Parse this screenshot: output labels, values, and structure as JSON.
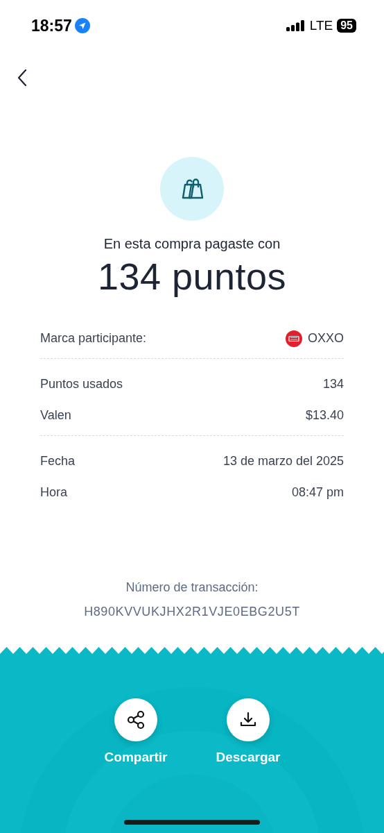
{
  "status_bar": {
    "time": "18:57",
    "network": "LTE",
    "battery": "95"
  },
  "summary": {
    "intro": "En esta compra pagaste con",
    "points": "134 puntos"
  },
  "detail_groups": [
    {
      "rows": [
        {
          "kind": "brand",
          "label": "Marca participante:",
          "value": "OXXO"
        }
      ]
    },
    {
      "rows": [
        {
          "kind": "text",
          "label": "Puntos usados",
          "value": "134"
        },
        {
          "kind": "text",
          "label": "Valen",
          "value": "$13.40"
        }
      ]
    },
    {
      "rows": [
        {
          "kind": "text",
          "label": "Fecha",
          "value": "13 de marzo del 2025"
        },
        {
          "kind": "text",
          "label": "Hora",
          "value": "08:47 pm"
        }
      ]
    }
  ],
  "transaction": {
    "label": "Número de transacción:",
    "number": "H890KVVUKJHX2R1VJE0EBG2U5T"
  },
  "actions": [
    {
      "kind": "share",
      "label": "Compartir"
    },
    {
      "kind": "download",
      "label": "Descargar"
    }
  ]
}
